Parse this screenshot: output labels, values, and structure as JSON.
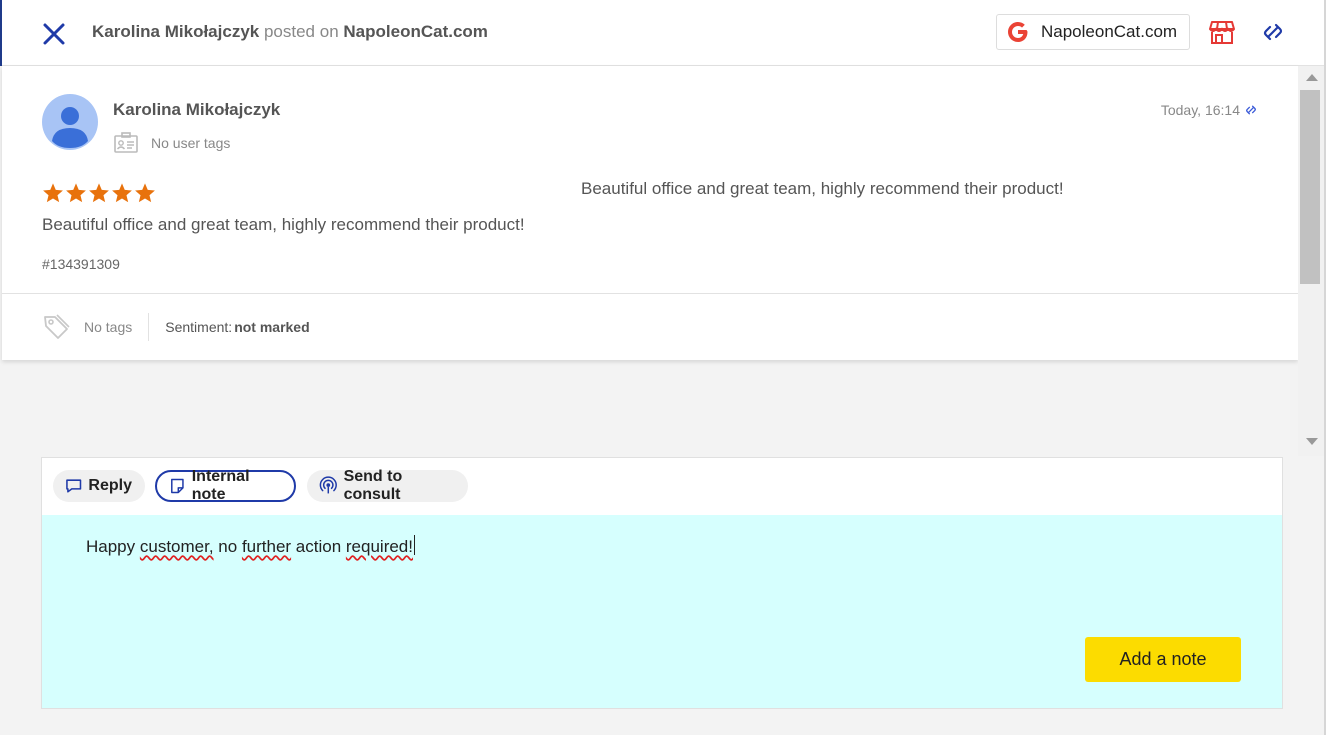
{
  "header": {
    "author": "Karolina Mikołajczyk",
    "posted_on": "posted on",
    "site": "NapoleonCat.com",
    "source_button_label": "NapoleonCat.com"
  },
  "review": {
    "author": "Karolina Mikołajczyk",
    "user_tags": "No user tags",
    "time": "Today, 16:14",
    "rating": 5,
    "text_side": "Beautiful office and great team, highly recommend their product!",
    "text": "Beautiful office and great team, highly recommend their product!",
    "id": "#134391309",
    "tags": "No tags",
    "sentiment_label": "Sentiment:",
    "sentiment_value": "not marked"
  },
  "composer": {
    "tabs": [
      {
        "label": "Reply",
        "active": false
      },
      {
        "label": "Internal note",
        "active": true
      },
      {
        "label": "Send to consult",
        "active": false
      }
    ],
    "note_text": {
      "p1": "Happy ",
      "w1": "customer,",
      "p2": " no ",
      "w2": "further",
      "p3": " action ",
      "w3": "required!"
    },
    "submit_label": "Add a note"
  },
  "colors": {
    "accent": "#1f3aa8",
    "star": "#e8720c",
    "note_bg": "#d6fffe",
    "button_yellow": "#fcdc00",
    "store_icon": "#e53935"
  },
  "icons": {
    "close": "close-icon",
    "google": "google-icon",
    "store": "store-icon",
    "unlink": "unlink-icon",
    "avatar": "user-avatar-icon",
    "user_card": "id-card-icon",
    "tag": "tag-icon",
    "reply": "speech-bubble-icon",
    "note": "sticky-note-icon",
    "consult": "broadcast-icon"
  }
}
